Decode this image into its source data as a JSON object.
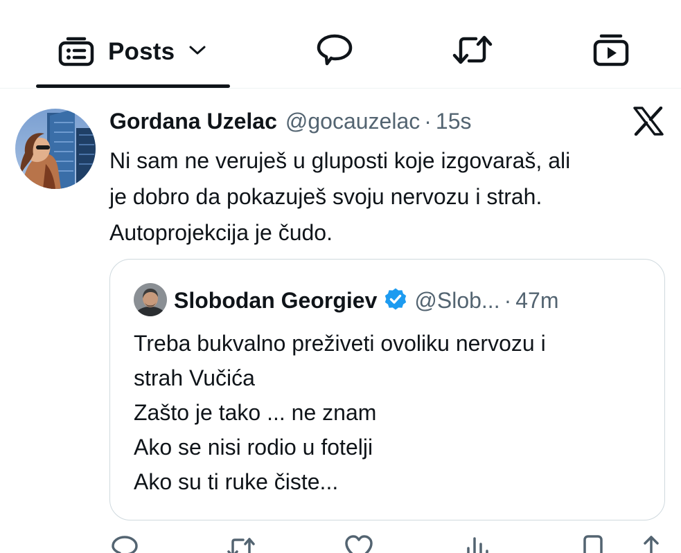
{
  "tabs": {
    "posts_label": "Posts",
    "icons": [
      "posts-icon",
      "chevron-down-icon",
      "reply-bubble-icon",
      "repost-icon",
      "video-icon"
    ]
  },
  "post": {
    "author_name": "Gordana Uzelac",
    "author_handle": "@gocauzelac",
    "separator": "·",
    "time": "15s",
    "text": "Ni sam ne veruješ u gluposti koje izgovaraš, ali\nje dobro da pokazuješ svoju  nervozu i strah.\nAutoprojekcija je čudo.",
    "source_icon": "x-logo-icon"
  },
  "quote": {
    "author_name": "Slobodan Georgiev",
    "author_handle": "@Slob...",
    "separator": "·",
    "time": "47m",
    "text": "Treba bukvalno preživeti ovoliku nervozu i\nstrah Vučića\nZašto je tako ... ne znam\nAko se nisi rodio u fotelji\nAko su ti ruke čiste...",
    "verified_icon": "verified-badge-icon"
  },
  "actions": [
    "reply-icon",
    "repost-icon",
    "like-icon",
    "views-icon",
    "bookmark-icon",
    "share-icon"
  ],
  "colors": {
    "text_primary": "#0f1419",
    "text_secondary": "#536471",
    "border": "#cfd9de",
    "verified_blue": "#1d9bf0"
  }
}
